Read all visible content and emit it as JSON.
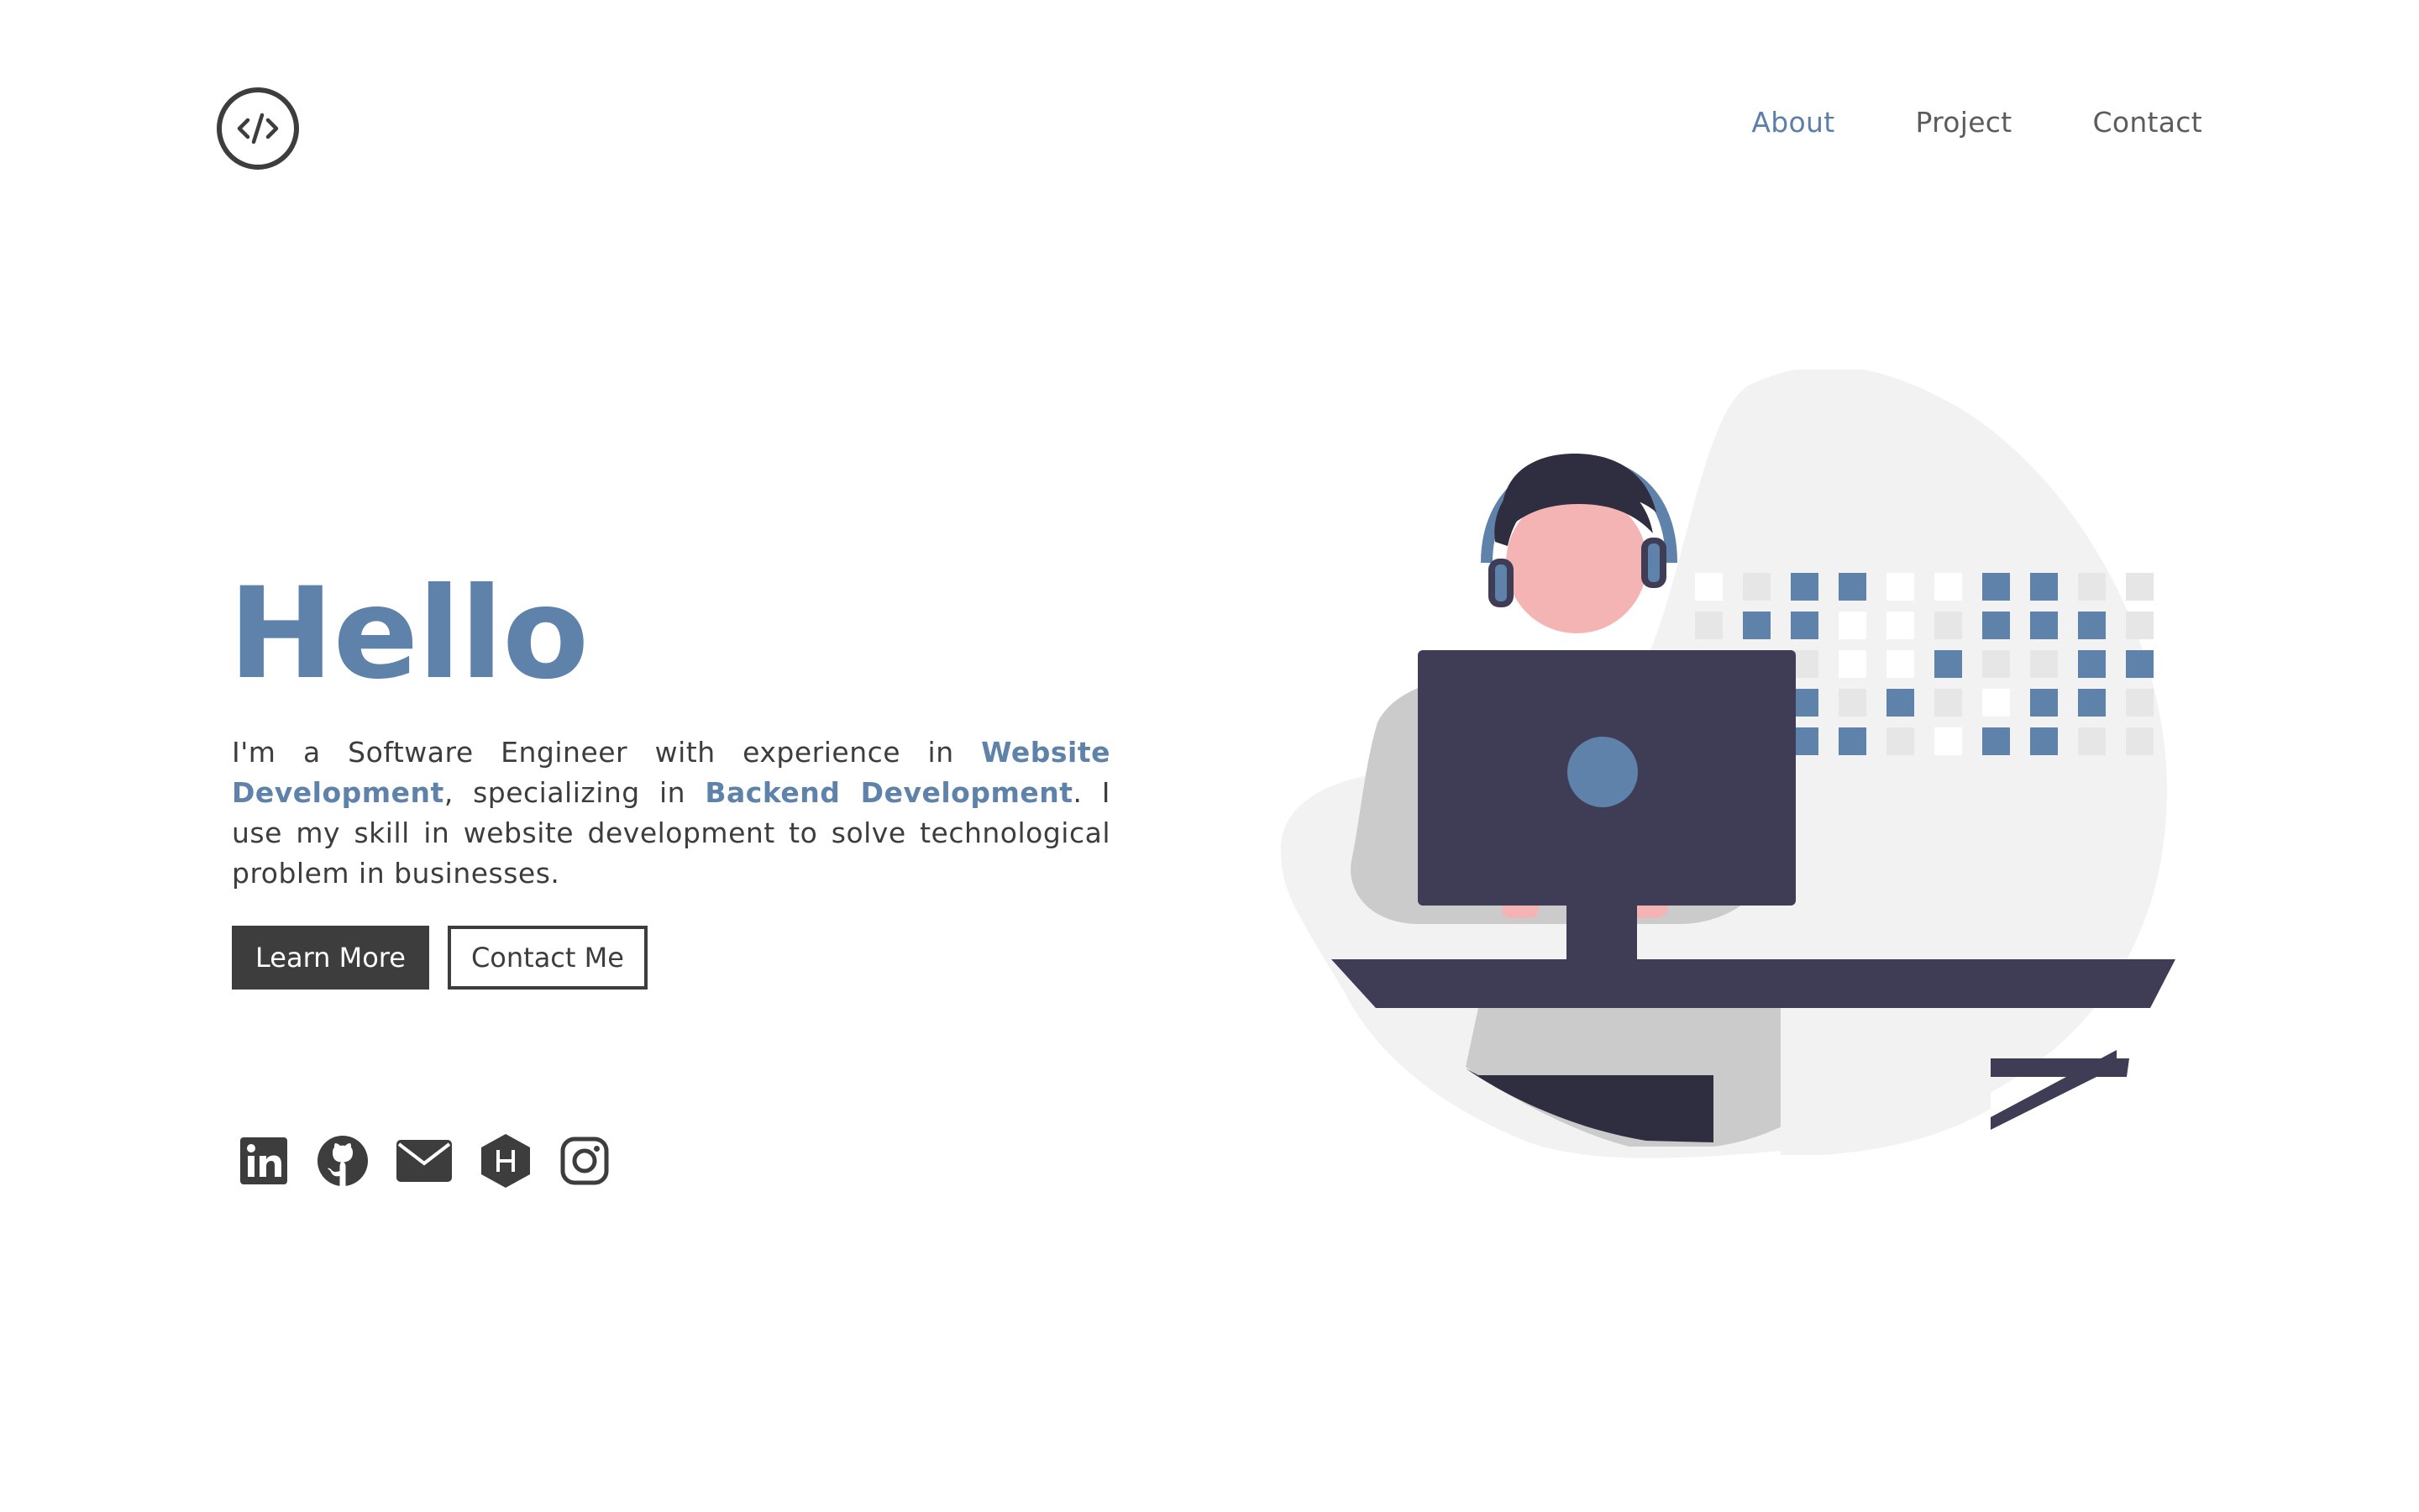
{
  "header": {
    "logo_icon": "code-brackets-icon",
    "nav": [
      {
        "label": "About",
        "active": true
      },
      {
        "label": "Project",
        "active": false
      },
      {
        "label": "Contact",
        "active": false
      }
    ]
  },
  "hero": {
    "title": "Hello",
    "intro_part1": "I'm a Software Engineer with experience in ",
    "highlight1": "Website Development",
    "intro_part2": ", specializing in ",
    "highlight2": "Backend Development",
    "intro_part3": ". I use my skill in website development to solve technological problem in businesses.",
    "learn_more_label": "Learn More",
    "contact_me_label": "Contact Me"
  },
  "socials": [
    {
      "icon": "linkedin-icon"
    },
    {
      "icon": "github-icon"
    },
    {
      "icon": "email-icon"
    },
    {
      "icon": "hashnode-icon"
    },
    {
      "icon": "instagram-icon"
    }
  ],
  "colors": {
    "accent": "#5f82ab",
    "dark": "#3d3d3d",
    "monitor": "#3f3d56",
    "skin": "#f4b4b4",
    "blob": "#f2f2f2"
  }
}
